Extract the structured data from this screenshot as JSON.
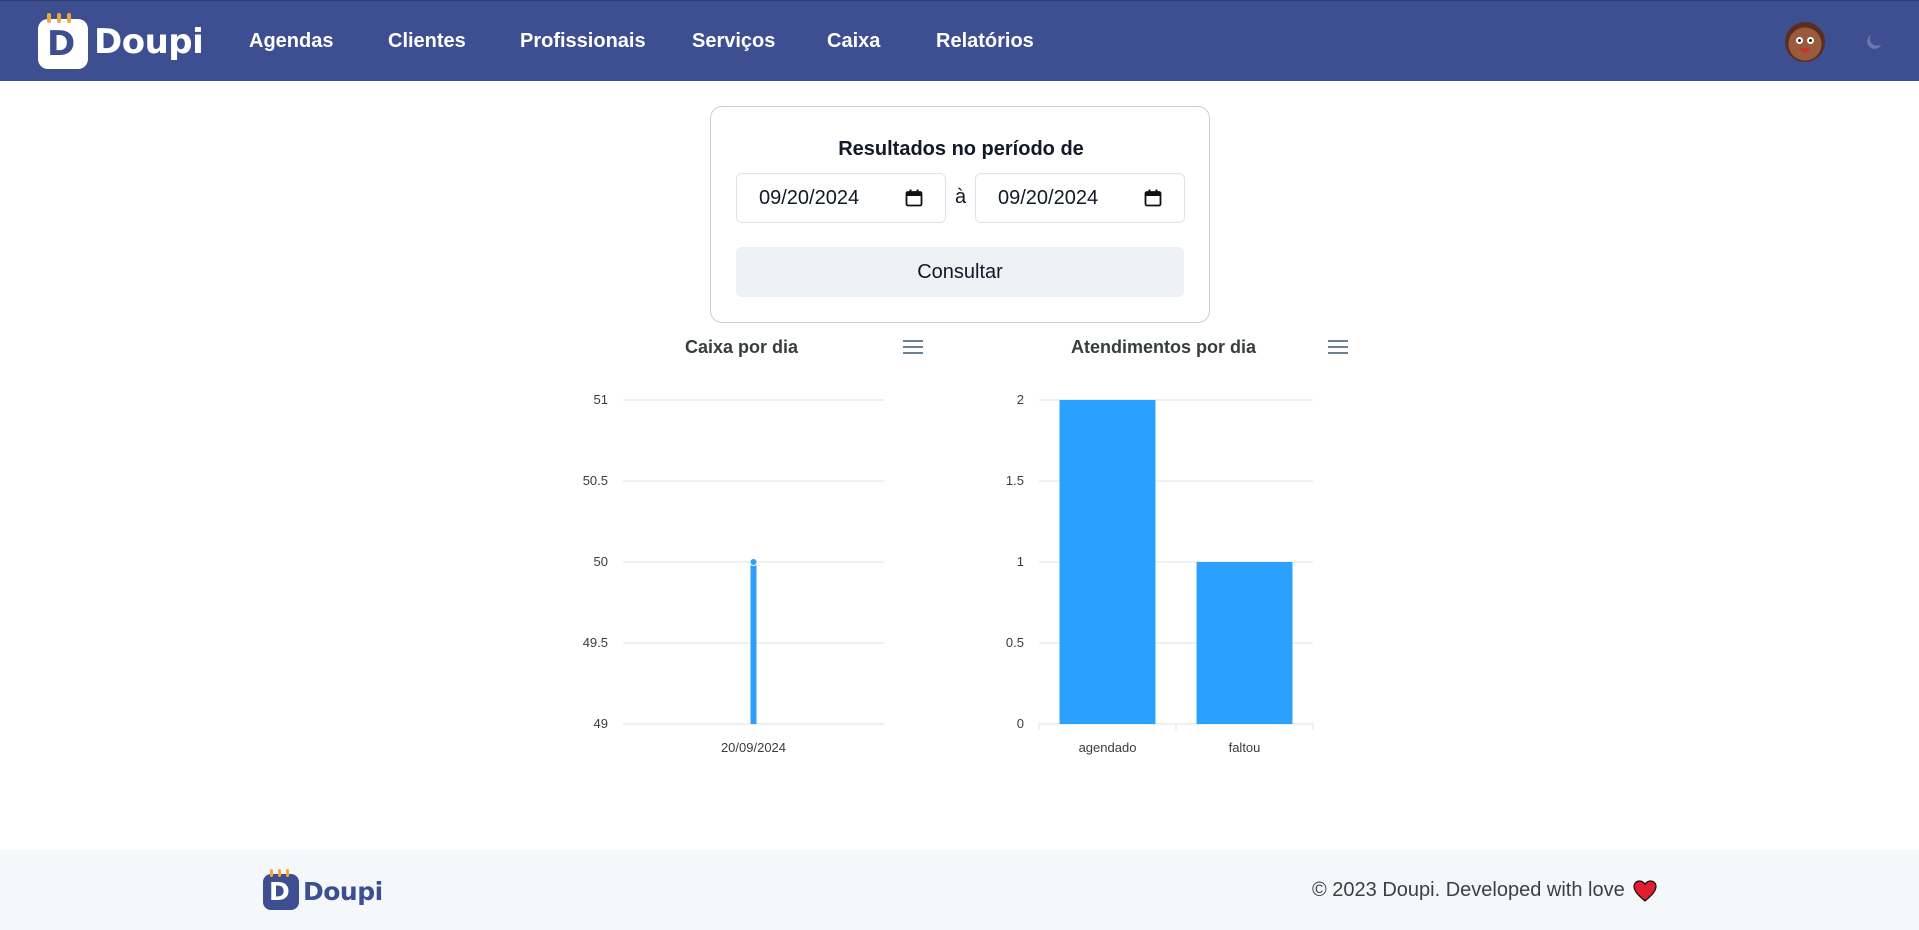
{
  "brand": {
    "name": "Doupi",
    "logo_letter": "D",
    "primary_color": "#3d4e91",
    "accent_color": "#f2a73b"
  },
  "nav": {
    "items": [
      "Agendas",
      "Clientes",
      "Profissionais",
      "Serviços",
      "Caixa",
      "Relatórios"
    ],
    "avatar_icon": "user-avatar",
    "theme_toggle_icon": "moon-icon"
  },
  "filter": {
    "title": "Resultados no período de",
    "start_date": "09/20/2024",
    "separator": "à",
    "end_date": "09/20/2024",
    "submit_label": "Consultar",
    "date_icon": "calendar-icon"
  },
  "chart_data": [
    {
      "type": "bar",
      "title": "Caixa por dia",
      "categories": [
        "20/09/2024"
      ],
      "values": [
        50
      ],
      "ylim": [
        49,
        51
      ],
      "yticks": [
        "51",
        "50.5",
        "50",
        "49.5",
        "49"
      ],
      "color": "#2e9dfb",
      "grid": true,
      "marker": true
    },
    {
      "type": "bar",
      "title": "Atendimentos por dia",
      "categories": [
        "agendado",
        "faltou"
      ],
      "values": [
        2,
        1
      ],
      "ylim": [
        0,
        2
      ],
      "yticks": [
        "2",
        "1.5",
        "1",
        "0.5",
        "0"
      ],
      "color": "#2ba0fc",
      "grid": true
    }
  ],
  "footer": {
    "brand": "Doupi",
    "copyright": "© 2023 Doupi. Developed with love",
    "heart_icon": "heart-icon",
    "heart_color": "#e11d2e"
  }
}
